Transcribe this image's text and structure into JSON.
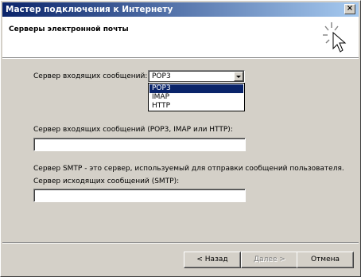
{
  "window": {
    "title": "Мастер подключения к Интернету",
    "close_glyph": "×"
  },
  "header": {
    "heading": "Серверы электронной почты",
    "icon": "wizard-wand-icon"
  },
  "form": {
    "incoming_type_label": "Сервер входящих сообщений:",
    "incoming_type_select": {
      "value": "POP3",
      "options": [
        "POP3",
        "IMAP",
        "HTTP"
      ],
      "highlighted_option": "POP3"
    },
    "incoming_server_label": "Сервер входящих сообщений (POP3, IMAP или HTTP):",
    "incoming_server_value": "",
    "smtp_description": "Сервер SMTP - это сервер, используемый для отправки сообщений пользователя.",
    "outgoing_server_label": "Сервер исходящих сообщений (SMTP):",
    "outgoing_server_value": ""
  },
  "buttons": {
    "back": "< Назад",
    "next": "Далее >",
    "cancel": "Отмена"
  },
  "colors": {
    "face": "#d4d0c8",
    "title_start": "#0a246a",
    "title_end": "#a6caf0",
    "selection": "#0a246a"
  }
}
